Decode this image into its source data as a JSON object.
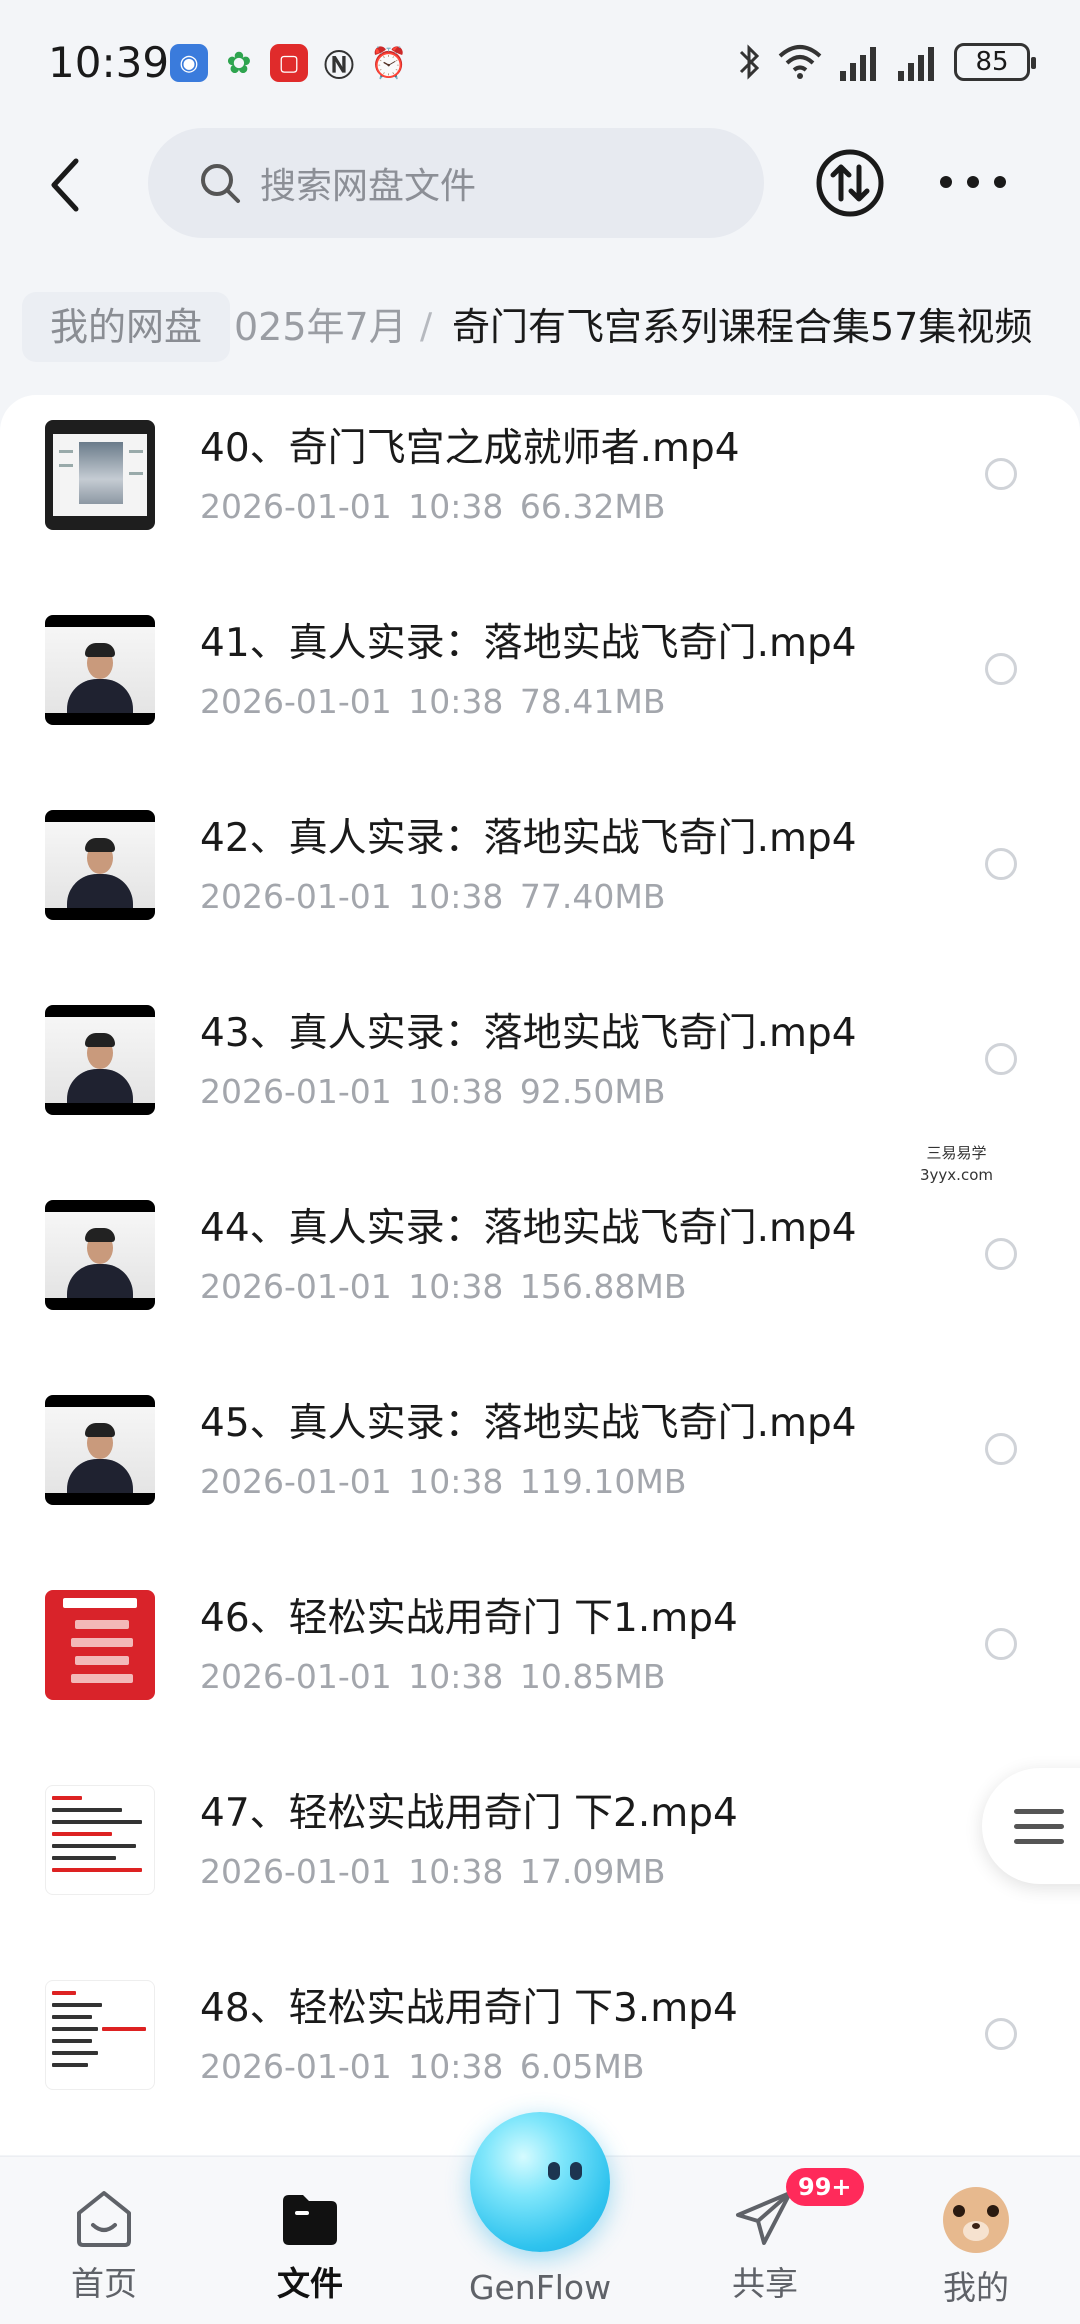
{
  "status_bar": {
    "time": "10:39",
    "battery": "85",
    "icons": [
      "bluetooth-icon",
      "wifi-icon",
      "signal-icon",
      "signal-icon"
    ]
  },
  "header": {
    "search_placeholder": "搜索网盘文件"
  },
  "breadcrumb": {
    "home": "我的网盘",
    "middle": "025年7月",
    "separator": "/",
    "current": "奇门有飞宫系列课程合集57集视频"
  },
  "files": [
    {
      "name": "40、奇门飞宫之成就师者.mp4",
      "date": "2026-01-01",
      "time": "10:38",
      "size": "66.32MB",
      "thumb": "book"
    },
    {
      "name": "41、真人实录：落地实战飞奇门.mp4",
      "date": "2026-01-01",
      "time": "10:38",
      "size": "78.41MB",
      "thumb": "video"
    },
    {
      "name": "42、真人实录：落地实战飞奇门.mp4",
      "date": "2026-01-01",
      "time": "10:38",
      "size": "77.40MB",
      "thumb": "video"
    },
    {
      "name": "43、真人实录：落地实战飞奇门.mp4",
      "date": "2026-01-01",
      "time": "10:38",
      "size": "92.50MB",
      "thumb": "video"
    },
    {
      "name": "44、真人实录：落地实战飞奇门.mp4",
      "date": "2026-01-01",
      "time": "10:38",
      "size": "156.88MB",
      "thumb": "video"
    },
    {
      "name": "45、真人实录：落地实战飞奇门.mp4",
      "date": "2026-01-01",
      "time": "10:38",
      "size": "119.10MB",
      "thumb": "video"
    },
    {
      "name": "46、轻松实战用奇门 下1.mp4",
      "date": "2026-01-01",
      "time": "10:38",
      "size": "10.85MB",
      "thumb": "red"
    },
    {
      "name": "47、轻松实战用奇门 下2.mp4",
      "date": "2026-01-01",
      "time": "10:38",
      "size": "17.09MB",
      "thumb": "doc"
    },
    {
      "name": "48、轻松实战用奇门 下3.mp4",
      "date": "2026-01-01",
      "time": "10:38",
      "size": "6.05MB",
      "thumb": "doc"
    }
  ],
  "watermark": {
    "line1": "三易易学",
    "line2": "3yyx.com"
  },
  "bottom_nav": {
    "home": "首页",
    "files": "文件",
    "genflow": "GenFlow",
    "share": "共享",
    "share_badge": "99+",
    "me": "我的"
  },
  "colors": {
    "accent_badge": "#ff2a5a",
    "orb": "#2fc3ee",
    "meta_text": "#a3a6ac"
  }
}
